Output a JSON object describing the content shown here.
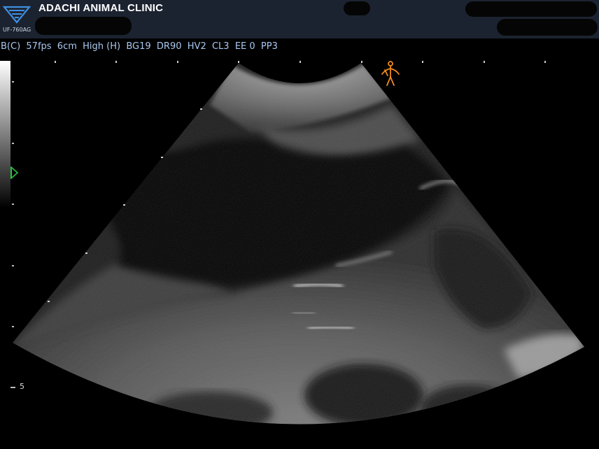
{
  "header": {
    "clinic_name": "ADACHI ANIMAL CLINIC",
    "model": "UF-760AG",
    "logo_icon": "fukuda-logo-icon",
    "background_color": "#1c2330"
  },
  "imaging_params": "B(C)  57fps  6cm  High (H)  BG19  DR90  HV2  CL3  EE 0  PP3",
  "scale": {
    "depth_marker_label": "5",
    "focus_icon": "focus-marker-icon"
  },
  "body_mark_icon": "body-mark-icon",
  "colors": {
    "param_text": "#a9c8f0",
    "focus_marker": "#27c23a",
    "body_mark": "#f08a1c"
  }
}
